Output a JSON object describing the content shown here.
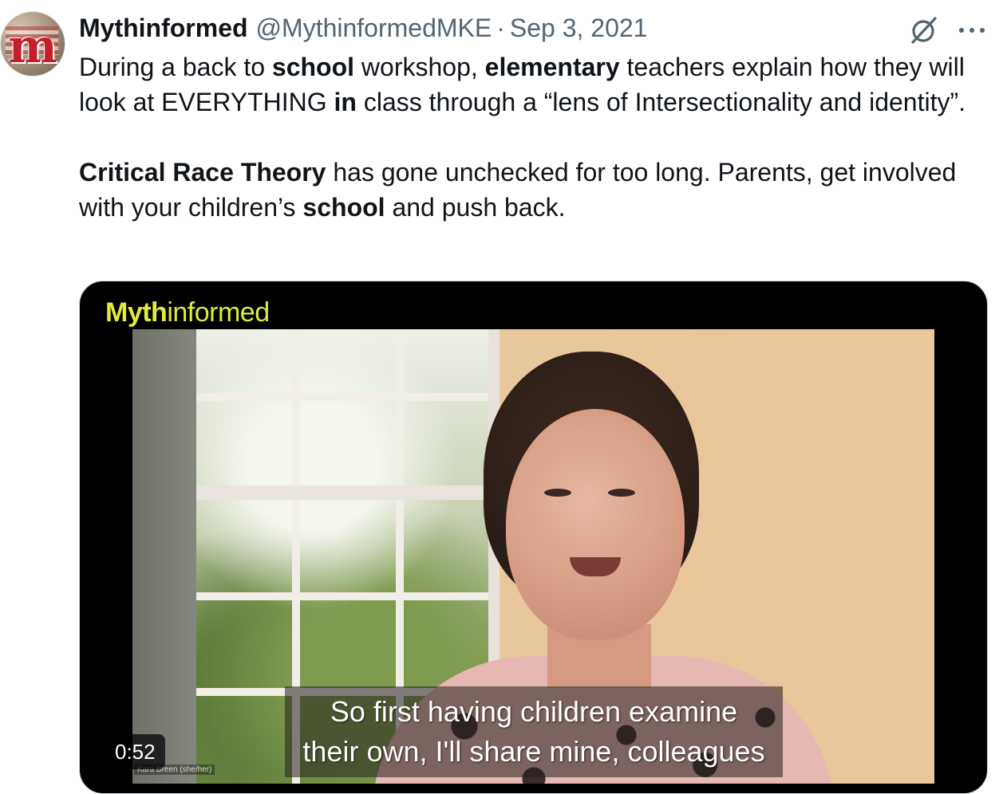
{
  "author": {
    "name": "Mythinformed",
    "handle": "@MythinformedMKE",
    "separator": "·",
    "date": "Sep 3, 2021",
    "avatar_letter": "m"
  },
  "icons": {
    "grok": "grok-icon",
    "more": "more-icon"
  },
  "tweet": {
    "p1": [
      {
        "text": "During a back to ",
        "bold": false
      },
      {
        "text": "school",
        "bold": true
      },
      {
        "text": " workshop, ",
        "bold": false
      },
      {
        "text": "elementary",
        "bold": true
      },
      {
        "text": " teachers explain how they will look at EVERYTHING ",
        "bold": false
      },
      {
        "text": "in",
        "bold": true
      },
      {
        "text": " class through a “lens of Intersectionality and identity”.",
        "bold": false
      }
    ],
    "p2": [
      {
        "text": "Critical Race Theory",
        "bold": true
      },
      {
        "text": " has gone unchecked for too long. Parents, get involved with your children’s ",
        "bold": false
      },
      {
        "text": "school",
        "bold": true
      },
      {
        "text": " and push back.",
        "bold": false
      }
    ]
  },
  "video": {
    "brand_bold": "Myth",
    "brand_rest": "informed",
    "caption_line1": "So first having children examine",
    "caption_line2": "their own, I'll share mine, colleagues",
    "nameplate": "Kara Breen (she/her)",
    "duration": "0:52"
  },
  "colors": {
    "text_primary": "#0f1419",
    "text_secondary": "#536471",
    "brand_yellow": "#e1ea3a",
    "media_border": "#cfd9de"
  }
}
